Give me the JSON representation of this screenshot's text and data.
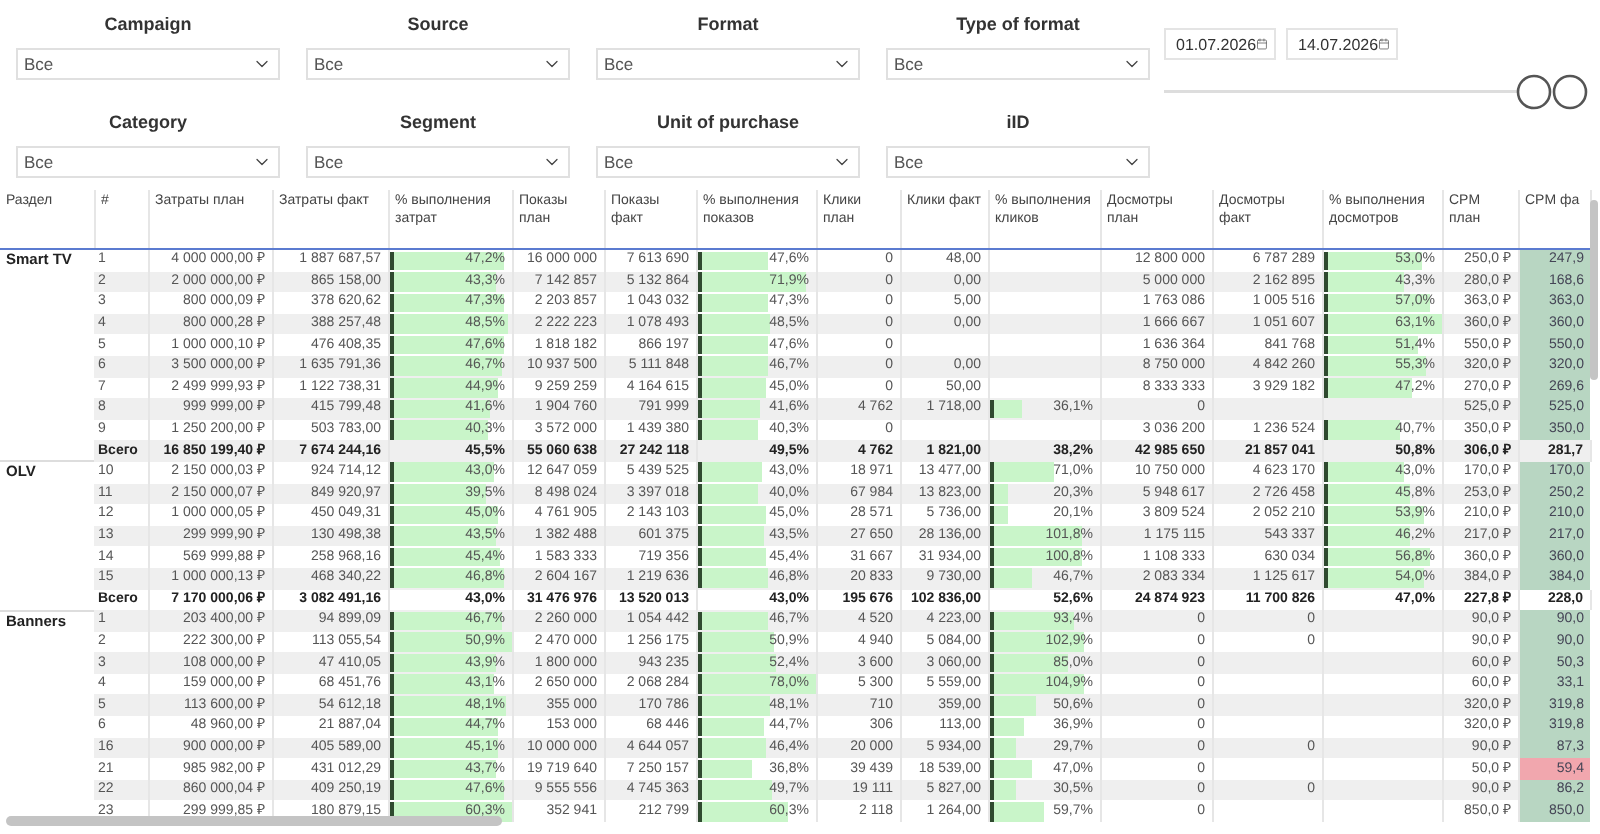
{
  "filters": [
    {
      "label": "Campaign",
      "value": "Все"
    },
    {
      "label": "Source",
      "value": "Все"
    },
    {
      "label": "Format",
      "value": "Все"
    },
    {
      "label": "Type of format",
      "value": "Все"
    },
    {
      "label": "Category",
      "value": "Все"
    },
    {
      "label": "Segment",
      "value": "Все"
    },
    {
      "label": "Unit of purchase",
      "value": "Все"
    },
    {
      "label": "iID",
      "value": "Все"
    }
  ],
  "dates": {
    "start": "01.07.2026",
    "end": "14.07.2026"
  },
  "table": {
    "columns": [
      "Раздел",
      "#",
      "Затраты план",
      "Затраты факт",
      "% выполнения затрат",
      "Показы план",
      "Показы факт",
      "% выполнения показов",
      "Клики план",
      "Клики факт",
      "% выполнения кликов",
      "Досмотры план",
      "Досмотры факт",
      "% выполнения досмотров",
      "CPM план",
      "CPM фа"
    ],
    "sections": [
      {
        "name": "Smart TV",
        "rows": [
          {
            "kind": "item",
            "n": "1",
            "cells": [
              "4 000 000,00 ₽",
              "1 887 687,57",
              {
                "text": "47,2%",
                "level": 0.94
              },
              "16 000 000",
              "7 613 690",
              {
                "text": "47,6%",
                "level": 0.61
              },
              "0",
              "48,00",
              null,
              "12 800 000",
              "6 787 289",
              {
                "text": "53,0%",
                "level": 0.84
              },
              "250,0 ₽",
              {
                "text": "247,9",
                "over": false
              }
            ]
          },
          {
            "kind": "item",
            "n": "2",
            "cells": [
              "2 000 000,00 ₽",
              "865 158,00",
              {
                "text": "43,3%",
                "level": 0.87
              },
              "7 142 857",
              "5 132 864",
              {
                "text": "71,9%",
                "level": 0.92
              },
              "0",
              "0,00",
              null,
              "5 000 000",
              "2 162 895",
              {
                "text": "43,3%",
                "level": 0.69
              },
              "280,0 ₽",
              {
                "text": "168,6",
                "over": false
              }
            ]
          },
          {
            "kind": "item",
            "n": "3",
            "cells": [
              "800 000,09 ₽",
              "378 620,62",
              {
                "text": "47,3%",
                "level": 0.95
              },
              "2 203 857",
              "1 043 032",
              {
                "text": "47,3%",
                "level": 0.61
              },
              "0",
              "5,00",
              null,
              "1 763 086",
              "1 005 516",
              {
                "text": "57,0%",
                "level": 0.9
              },
              "363,0 ₽",
              {
                "text": "363,0",
                "over": false
              }
            ]
          },
          {
            "kind": "item",
            "n": "4",
            "cells": [
              "800 000,28 ₽",
              "388 257,48",
              {
                "text": "48,5%",
                "level": 0.97
              },
              "2 222 223",
              "1 078 493",
              {
                "text": "48,5%",
                "level": 0.62
              },
              "0",
              "0,00",
              null,
              "1 666 667",
              "1 051 607",
              {
                "text": "63,1%",
                "level": 1
              },
              "360,0 ₽",
              {
                "text": "360,0",
                "over": false
              }
            ]
          },
          {
            "kind": "item",
            "n": "5",
            "cells": [
              "1 000 000,10 ₽",
              "476 408,35",
              {
                "text": "47,6%",
                "level": 0.95
              },
              "1 818 182",
              "866 197",
              {
                "text": "47,6%",
                "level": 0.61
              },
              "0",
              null,
              null,
              "1 636 364",
              "841 768",
              {
                "text": "51,4%",
                "level": 0.81
              },
              "550,0 ₽",
              {
                "text": "550,0",
                "over": false
              }
            ]
          },
          {
            "kind": "item",
            "n": "6",
            "cells": [
              "3 500 000,00 ₽",
              "1 635 791,36",
              {
                "text": "46,7%",
                "level": 0.93
              },
              "10 937 500",
              "5 111 848",
              {
                "text": "46,7%",
                "level": 0.6
              },
              "0",
              "0,00",
              null,
              "8 750 000",
              "4 842 260",
              {
                "text": "55,3%",
                "level": 0.88
              },
              "320,0 ₽",
              {
                "text": "320,0",
                "over": false
              }
            ]
          },
          {
            "kind": "item",
            "n": "7",
            "cells": [
              "2 499 999,93 ₽",
              "1 122 738,31",
              {
                "text": "44,9%",
                "level": 0.9
              },
              "9 259 259",
              "4 164 615",
              {
                "text": "45,0%",
                "level": 0.58
              },
              "0",
              "50,00",
              null,
              "8 333 333",
              "3 929 182",
              {
                "text": "47,2%",
                "level": 0.75
              },
              "270,0 ₽",
              {
                "text": "269,6",
                "over": false
              }
            ]
          },
          {
            "kind": "item",
            "n": "8",
            "cells": [
              "999 999,00 ₽",
              "415 799,48",
              {
                "text": "41,6%",
                "level": 0.83
              },
              "1 904 760",
              "791 999",
              {
                "text": "41,6%",
                "level": 0.53
              },
              "4 762",
              "1 718,00",
              {
                "text": "36,1%",
                "level": 0.3
              },
              "0",
              null,
              null,
              "525,0 ₽",
              {
                "text": "525,0",
                "over": false
              }
            ]
          },
          {
            "kind": "item",
            "n": "9",
            "cells": [
              "1 250 200,00 ₽",
              "503 783,00",
              {
                "text": "40,3%",
                "level": 0.81
              },
              "3 572 000",
              "1 439 380",
              {
                "text": "40,3%",
                "level": 0.52
              },
              "0",
              null,
              null,
              "3 036 200",
              "1 236 524",
              {
                "text": "40,7%",
                "level": 0.65
              },
              "350,0 ₽",
              {
                "text": "350,0",
                "over": false
              }
            ]
          },
          {
            "kind": "total",
            "n": "Всего",
            "cells": [
              "16 850 199,40 ₽",
              "7 674 244,16",
              "45,5%",
              "55 060 638",
              "27 242 118",
              "49,5%",
              "4 762",
              "1 821,00",
              "38,2%",
              "42 985 650",
              "21 857 041",
              "50,8%",
              "306,0 ₽",
              "281,7"
            ]
          }
        ]
      },
      {
        "name": "OLV",
        "rows": [
          {
            "kind": "item",
            "n": "10",
            "cells": [
              "2 150 000,03 ₽",
              "924 714,12",
              {
                "text": "43,0%",
                "level": 0.86
              },
              "12 647 059",
              "5 439 525",
              {
                "text": "43,0%",
                "level": 0.55
              },
              "18 971",
              "13 477,00",
              {
                "text": "71,0%",
                "level": 0.59
              },
              "10 750 000",
              "4 623 170",
              {
                "text": "43,0%",
                "level": 0.68
              },
              "170,0 ₽",
              {
                "text": "170,0",
                "over": false
              }
            ]
          },
          {
            "kind": "item",
            "n": "11",
            "cells": [
              "2 150 000,07 ₽",
              "849 920,97",
              {
                "text": "39,5%",
                "level": 0.79
              },
              "8 498 024",
              "3 397 018",
              {
                "text": "40,0%",
                "level": 0.51
              },
              "67 984",
              "13 823,00",
              {
                "text": "20,3%",
                "level": 0.17
              },
              "5 948 617",
              "2 726 458",
              {
                "text": "45,8%",
                "level": 0.73
              },
              "253,0 ₽",
              {
                "text": "250,2",
                "over": false
              }
            ]
          },
          {
            "kind": "item",
            "n": "12",
            "cells": [
              "1 000 000,05 ₽",
              "450 049,31",
              {
                "text": "45,0%",
                "level": 0.9
              },
              "4 761 905",
              "2 143 103",
              {
                "text": "45,0%",
                "level": 0.58
              },
              "28 571",
              "5 736,00",
              {
                "text": "20,1%",
                "level": 0.17
              },
              "3 809 524",
              "2 052 210",
              {
                "text": "53,9%",
                "level": 0.85
              },
              "210,0 ₽",
              {
                "text": "210,0",
                "over": false
              }
            ]
          },
          {
            "kind": "item",
            "n": "13",
            "cells": [
              "299 999,90 ₽",
              "130 498,38",
              {
                "text": "43,5%",
                "level": 0.87
              },
              "1 382 488",
              "601 375",
              {
                "text": "43,5%",
                "level": 0.56
              },
              "27 650",
              "28 136,00",
              {
                "text": "101,8%",
                "level": 0.85
              },
              "1 175 115",
              "543 337",
              {
                "text": "46,2%",
                "level": 0.73
              },
              "217,0 ₽",
              {
                "text": "217,0",
                "over": false
              }
            ]
          },
          {
            "kind": "item",
            "n": "14",
            "cells": [
              "569 999,88 ₽",
              "258 968,16",
              {
                "text": "45,4%",
                "level": 0.91
              },
              "1 583 333",
              "719 356",
              {
                "text": "45,4%",
                "level": 0.58
              },
              "31 667",
              "31 934,00",
              {
                "text": "100,8%",
                "level": 0.84
              },
              "1 108 333",
              "630 034",
              {
                "text": "56,8%",
                "level": 0.9
              },
              "360,0 ₽",
              {
                "text": "360,0",
                "over": false
              }
            ]
          },
          {
            "kind": "item",
            "n": "15",
            "cells": [
              "1 000 000,13 ₽",
              "468 340,22",
              {
                "text": "46,8%",
                "level": 0.94
              },
              "2 604 167",
              "1 219 636",
              {
                "text": "46,8%",
                "level": 0.6
              },
              "20 833",
              "9 730,00",
              {
                "text": "46,7%",
                "level": 0.39
              },
              "2 083 334",
              "1 125 617",
              {
                "text": "54,0%",
                "level": 0.86
              },
              "384,0 ₽",
              {
                "text": "384,0",
                "over": false
              }
            ]
          },
          {
            "kind": "total",
            "n": "Всего",
            "cells": [
              "7 170 000,06 ₽",
              "3 082 491,16",
              "43,0%",
              "31 476 976",
              "13 520 013",
              "43,0%",
              "195 676",
              "102 836,00",
              "52,6%",
              "24 874 923",
              "11 700 826",
              "47,0%",
              "227,8 ₽",
              "228,0"
            ]
          }
        ]
      },
      {
        "name": "Banners",
        "rows": [
          {
            "kind": "item",
            "n": "1",
            "cells": [
              "203 400,00 ₽",
              "94 899,09",
              {
                "text": "46,7%",
                "level": 0.93
              },
              "2 260 000",
              "1 054 442",
              {
                "text": "46,7%",
                "level": 0.6
              },
              "4 520",
              "4 223,00",
              {
                "text": "93,4%",
                "level": 0.78
              },
              "0",
              "0",
              null,
              "90,0 ₽",
              {
                "text": "90,0",
                "over": false
              }
            ]
          },
          {
            "kind": "item",
            "n": "2",
            "cells": [
              "222 300,00 ₽",
              "113 055,54",
              {
                "text": "50,9%",
                "level": 1
              },
              "2 470 000",
              "1 256 175",
              {
                "text": "50,9%",
                "level": 0.65
              },
              "4 940",
              "5 084,00",
              {
                "text": "102,9%",
                "level": 0.86
              },
              "0",
              "0",
              null,
              "90,0 ₽",
              {
                "text": "90,0",
                "over": false
              }
            ]
          },
          {
            "kind": "item",
            "n": "3",
            "cells": [
              "108 000,00 ₽",
              "47 410,05",
              {
                "text": "43,9%",
                "level": 0.88
              },
              "1 800 000",
              "943 235",
              {
                "text": "52,4%",
                "level": 0.67
              },
              "3 600",
              "3 060,00",
              {
                "text": "85,0%",
                "level": 0.71
              },
              "0",
              null,
              null,
              "60,0 ₽",
              {
                "text": "50,3",
                "over": false
              }
            ]
          },
          {
            "kind": "item",
            "n": "4",
            "cells": [
              "159 000,00 ₽",
              "68 451,76",
              {
                "text": "43,1%",
                "level": 0.86
              },
              "2 650 000",
              "2 068 284",
              {
                "text": "78,0%",
                "level": 1
              },
              "5 300",
              "5 559,00",
              {
                "text": "104,9%",
                "level": 0.87
              },
              "0",
              null,
              null,
              "60,0 ₽",
              {
                "text": "33,1",
                "over": false
              }
            ]
          },
          {
            "kind": "item",
            "n": "5",
            "cells": [
              "113 600,00 ₽",
              "54 612,18",
              {
                "text": "48,1%",
                "level": 0.96
              },
              "355 000",
              "170 786",
              {
                "text": "48,1%",
                "level": 0.62
              },
              "710",
              "359,00",
              {
                "text": "50,6%",
                "level": 0.42
              },
              "0",
              null,
              null,
              "320,0 ₽",
              {
                "text": "319,8",
                "over": false
              }
            ]
          },
          {
            "kind": "item",
            "n": "6",
            "cells": [
              "48 960,00 ₽",
              "21 887,04",
              {
                "text": "44,7%",
                "level": 0.89
              },
              "153 000",
              "68 446",
              {
                "text": "44,7%",
                "level": 0.57
              },
              "306",
              "113,00",
              {
                "text": "36,9%",
                "level": 0.31
              },
              "0",
              null,
              null,
              "320,0 ₽",
              {
                "text": "319,8",
                "over": false
              }
            ]
          },
          {
            "kind": "item",
            "n": "16",
            "cells": [
              "900 000,00 ₽",
              "405 589,00",
              {
                "text": "45,1%",
                "level": 0.9
              },
              "10 000 000",
              "4 644 057",
              {
                "text": "46,4%",
                "level": 0.59
              },
              "20 000",
              "5 934,00",
              {
                "text": "29,7%",
                "level": 0.25
              },
              "0",
              "0",
              null,
              "90,0 ₽",
              {
                "text": "87,3",
                "over": false
              }
            ]
          },
          {
            "kind": "item",
            "n": "21",
            "cells": [
              "985 982,00 ₽",
              "431 012,29",
              {
                "text": "43,7%",
                "level": 0.87
              },
              "19 719 640",
              "7 250 157",
              {
                "text": "36,8%",
                "level": 0.47
              },
              "39 439",
              "18 539,00",
              {
                "text": "47,0%",
                "level": 0.39
              },
              "0",
              null,
              null,
              "50,0 ₽",
              {
                "text": "59,4",
                "over": true
              }
            ]
          },
          {
            "kind": "item",
            "n": "22",
            "cells": [
              "860 000,04 ₽",
              "409 250,19",
              {
                "text": "47,6%",
                "level": 0.95
              },
              "9 555 556",
              "4 745 363",
              {
                "text": "49,7%",
                "level": 0.64
              },
              "19 111",
              "5 827,00",
              {
                "text": "30,5%",
                "level": 0.25
              },
              "0",
              "0",
              null,
              "90,0 ₽",
              {
                "text": "86,2",
                "over": false
              }
            ]
          },
          {
            "kind": "item",
            "n": "23",
            "cells": [
              "299 999,85 ₽",
              "180 879,15",
              {
                "text": "60,3%",
                "level": 1
              },
              "352 941",
              "212 799",
              {
                "text": "60,3%",
                "level": 0.77
              },
              "2 118",
              "1 264,00",
              {
                "text": "59,7%",
                "level": 0.5
              },
              "0",
              null,
              null,
              "850,0 ₽",
              {
                "text": "850,0",
                "over": false
              }
            ]
          }
        ]
      }
    ]
  }
}
